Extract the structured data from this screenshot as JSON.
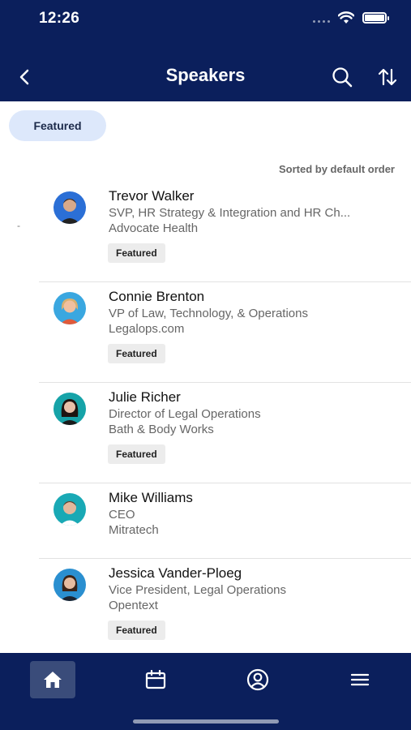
{
  "status": {
    "time": "12:26"
  },
  "header": {
    "title": "Speakers"
  },
  "filters": {
    "featured_label": "Featured"
  },
  "sort_note": "Sorted by default order",
  "side_tick": "-",
  "speakers": [
    {
      "name": "Trevor Walker",
      "title": "SVP, HR Strategy & Integration and HR Ch...",
      "company": "Advocate Health",
      "badge": "Featured",
      "avatar": {
        "bg": "#2b6fd6",
        "skin": "#d8a98a",
        "hair": "#3a2a20",
        "shirt": "#222222"
      }
    },
    {
      "name": "Connie Brenton",
      "title": "VP of Law, Technology, & Operations",
      "company": "Legalops.com",
      "badge": "Featured",
      "avatar": {
        "bg": "#3aa7e0",
        "skin": "#f0c0a0",
        "hair": "#d8b070",
        "shirt": "#e05a3a"
      }
    },
    {
      "name": "Julie Richer",
      "title": "Director of Legal Operations",
      "company": "Bath & Body Works",
      "badge": "Featured",
      "avatar": {
        "bg": "#16a3a8",
        "skin": "#e8c0a8",
        "hair": "#1e1410",
        "shirt": "#1a1a1a"
      }
    },
    {
      "name": "Mike Williams",
      "title": "CEO",
      "company": "Mitratech",
      "badge": "",
      "avatar": {
        "bg": "#19a9b5",
        "skin": "#e2b89c",
        "hair": "#5a3d2a",
        "shirt": "#ffffff"
      }
    },
    {
      "name": "Jessica Vander-Ploeg",
      "title": "Vice President, Legal Operations",
      "company": "Opentext",
      "badge": "Featured",
      "avatar": {
        "bg": "#2a8fd0",
        "skin": "#e6bca0",
        "hair": "#3b2418",
        "shirt": "#1c2430"
      }
    }
  ],
  "tabs": [
    {
      "name": "home",
      "icon": "home-icon",
      "active": true
    },
    {
      "name": "schedule",
      "icon": "calendar-icon",
      "active": false
    },
    {
      "name": "profile",
      "icon": "user-circle-icon",
      "active": false
    },
    {
      "name": "menu",
      "icon": "hamburger-menu-icon",
      "active": false
    }
  ],
  "colors": {
    "header_bg": "#0b1f5c",
    "chip_bg": "#dde8fb",
    "badge_bg": "#ececec"
  }
}
